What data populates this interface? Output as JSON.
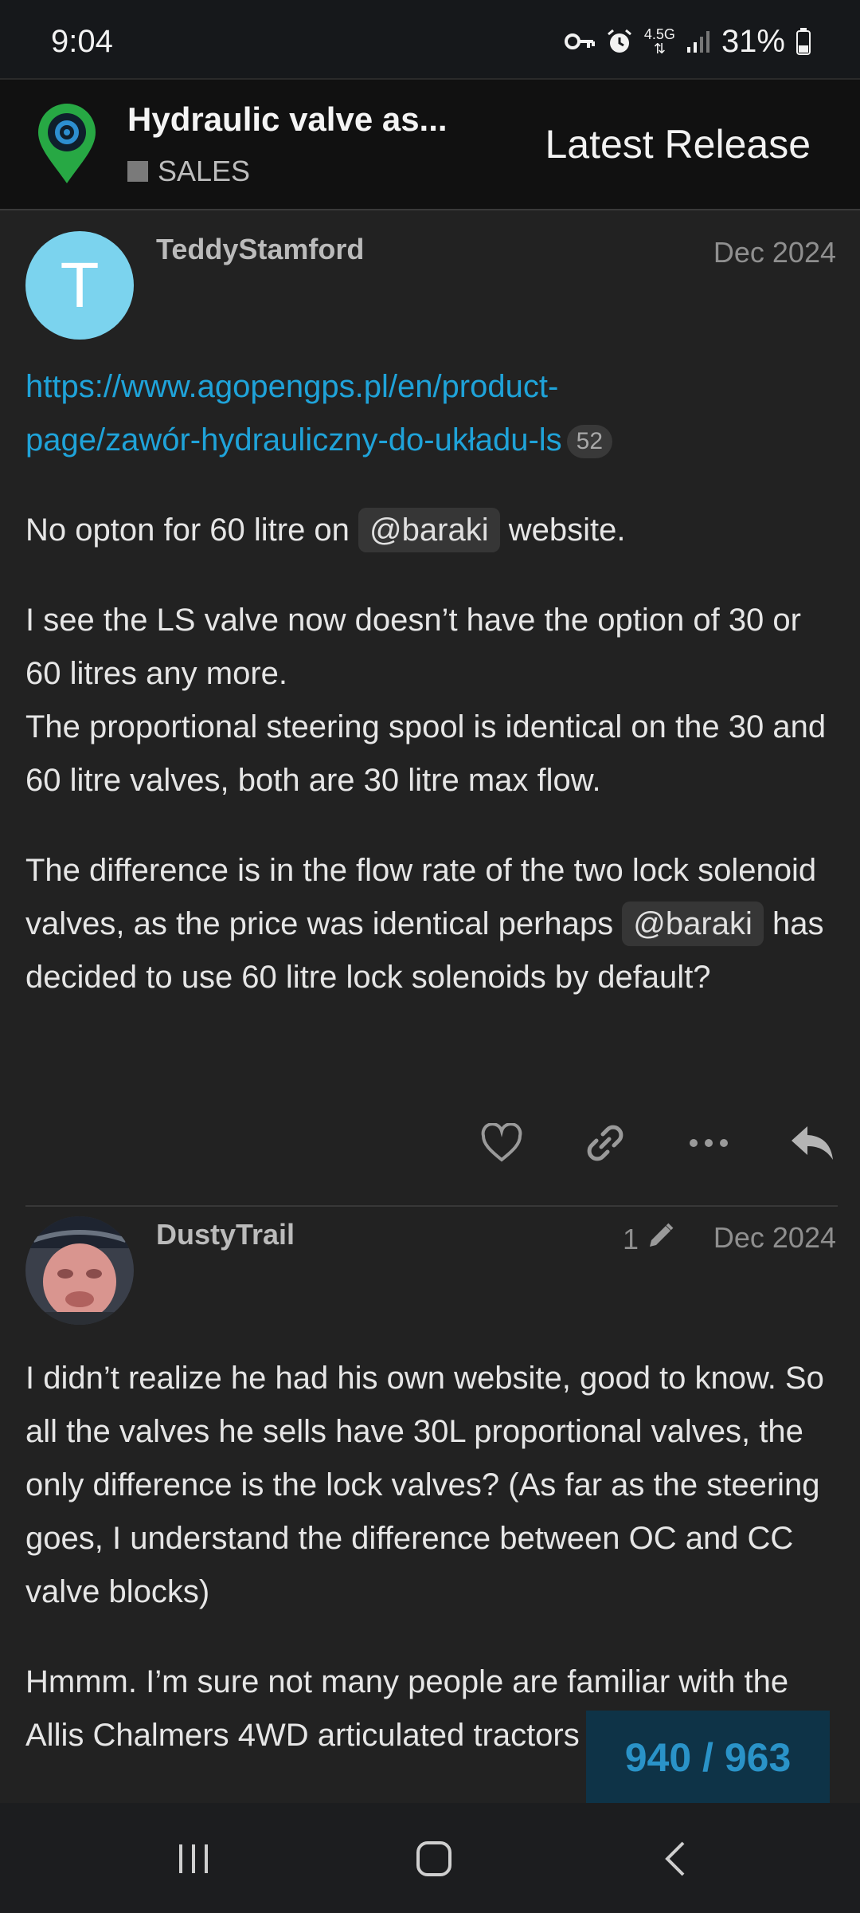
{
  "status_bar": {
    "time": "9:04",
    "network": "4.5G",
    "battery": "31%",
    "icons": [
      "key-icon",
      "alarm-icon",
      "network-icon",
      "signal-icon",
      "battery-icon"
    ]
  },
  "header": {
    "title": "Hydraulic valve as...",
    "category": "SALES",
    "latest_release": "Latest Release"
  },
  "posts": [
    {
      "avatar_letter": "T",
      "avatar_color": "#7bd3ee",
      "username": "TeddyStamford",
      "date": "Dec 2024",
      "link_line1": "https://www.agopengps.pl/en/product-",
      "link_line2": "page/zawór-hydrauliczny-do-układu-ls",
      "link_clicks": "52",
      "p1_before": "No opton for 60 litre on",
      "p1_mention": "@baraki",
      "p1_after": "website.",
      "p2": "I see the LS valve now doesn’t have the option of 30 or 60 litres any more.",
      "p3": "The proportional steering spool is identical on the 30 and 60 litre valves, both are 30 litre max flow.",
      "p4_before": "The difference is in the flow rate of the two lock solenoid valves, as the price was identical perhaps",
      "p4_mention": "@baraki",
      "p4_after": "has decided to use 60 litre lock solenoids by default?",
      "actions": [
        "heart-icon",
        "link-icon",
        "more-icon",
        "reply-icon"
      ]
    },
    {
      "username": "DustyTrail",
      "edit_count": "1",
      "date": "Dec 2024",
      "p1": "I didn’t realize he had his own website, good to know. So all the valves he sells have 30L proportional valves, the only difference is the lock valves? (As far as the steering goes, I understand the difference between OC and CC valve blocks)",
      "p2": "Hmmm. I’m sure not many people are familiar with the Allis Chalmers 4WD articulated tractors but the ones id like to put the valve on are..."
    }
  ],
  "progress": "940 / 963",
  "accent_color": "#1fa3d9"
}
